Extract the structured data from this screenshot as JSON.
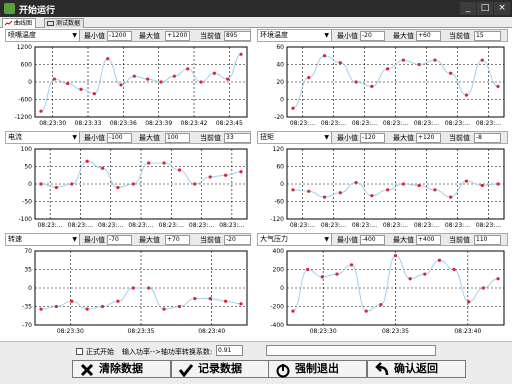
{
  "window": {
    "title": "开始运行",
    "buttons": {
      "minimize": "_",
      "maximize": "□",
      "close": "×"
    }
  },
  "tabs": [
    {
      "label": "曲线图"
    },
    {
      "label": "测试数据"
    }
  ],
  "labels": {
    "min": "最小值",
    "max": "最大值",
    "current": "当前值"
  },
  "panels": [
    {
      "name": "喷嘴温度",
      "min": "-1200",
      "max": "+1200",
      "current": "895",
      "chart_data": {
        "type": "line",
        "ylim": [
          -1200,
          1200
        ],
        "yticks": [
          "1200",
          "600",
          "0",
          "-600",
          "-1200"
        ],
        "xticks": [
          "08:23:30",
          "08:23:33",
          "08:23:36",
          "08:23:39",
          "08:23:42",
          "08:23:45"
        ],
        "values": [
          -1000,
          100,
          -50,
          -250,
          -400,
          800,
          -100,
          200,
          100,
          0,
          200,
          450,
          0,
          300,
          100,
          950
        ]
      }
    },
    {
      "name": "环境温度",
      "min": "-20",
      "max": "+60",
      "current": "15",
      "chart_data": {
        "type": "line",
        "ylim": [
          -20,
          60
        ],
        "yticks": [
          "60",
          "40",
          "20",
          "0",
          "-20"
        ],
        "xticks": [
          "08:23:…",
          "08:23:…",
          "08:23:…",
          "08:23:…",
          "08:23:…",
          "08:23:…",
          "08:23:…"
        ],
        "values": [
          -10,
          25,
          50,
          42,
          20,
          15,
          35,
          45,
          40,
          45,
          30,
          5,
          45,
          15
        ]
      }
    },
    {
      "name": "电流",
      "min": "-100",
      "max": "100",
      "current": "33",
      "chart_data": {
        "type": "line",
        "ylim": [
          -100,
          100
        ],
        "yticks": [
          "100",
          "50",
          "0",
          "-50",
          "-100"
        ],
        "xticks": [
          "08:23:…",
          "08:23:…",
          "08:23:…",
          "08:23:…",
          "08:23:…",
          "08:23:…",
          "08:23:…"
        ],
        "values": [
          0,
          -10,
          0,
          65,
          45,
          -10,
          0,
          60,
          60,
          40,
          0,
          20,
          25,
          35
        ]
      }
    },
    {
      "name": "扭矩",
      "min": "-120",
      "max": "+120",
      "current": "-8",
      "chart_data": {
        "type": "line",
        "ylim": [
          -120,
          120
        ],
        "yticks": [
          "120",
          "60",
          "0",
          "-60",
          "-120"
        ],
        "xticks": [
          "08:23:…",
          "08:23:…",
          "08:23:…",
          "08:23:…",
          "08:23:…",
          "08:23:…",
          "08:23:…"
        ],
        "values": [
          -20,
          -25,
          -45,
          -30,
          5,
          -40,
          -20,
          0,
          -5,
          -20,
          -45,
          10,
          -5,
          0
        ]
      }
    },
    {
      "name": "转速",
      "min": "-70",
      "max": "+70",
      "current": "-20",
      "chart_data": {
        "type": "line",
        "ylim": [
          -70,
          70
        ],
        "yticks": [
          "70",
          "35",
          "0",
          "-35",
          "-70"
        ],
        "xticks": [
          "08:23:30",
          "08:23:35",
          "08:23:40"
        ],
        "values": [
          -40,
          -35,
          -25,
          -40,
          -35,
          -25,
          0,
          0,
          -40,
          -35,
          -20,
          -20,
          -25,
          -30
        ]
      }
    },
    {
      "name": "大气压力",
      "min": "-400",
      "max": "+400",
      "current": "110",
      "chart_data": {
        "type": "line",
        "ylim": [
          -400,
          400
        ],
        "yticks": [
          "400",
          "200",
          "0",
          "-200",
          "-400"
        ],
        "xticks": [
          "08:23:30",
          "08:23:35",
          "08:23:40"
        ],
        "values": [
          -250,
          200,
          120,
          150,
          250,
          -250,
          -180,
          350,
          100,
          150,
          300,
          200,
          -150,
          0,
          100
        ]
      }
    }
  ],
  "bottom": {
    "checkbox_label": "正式开始",
    "ratio_label": "输入功率-->轴功率转换系数:",
    "ratio_value": "0.91",
    "status_value": ""
  },
  "buttons": [
    {
      "label": "清除数据",
      "icon": "x-icon"
    },
    {
      "label": "记录数据",
      "icon": "check-icon"
    },
    {
      "label": "强制退出",
      "icon": "power-icon"
    },
    {
      "label": "确认返回",
      "icon": "return-arrow-icon"
    }
  ],
  "colors": {
    "line": "#a0d0f0",
    "point": "#e0203c",
    "grid": "#000000",
    "titlebar": "#2b2b2b"
  }
}
